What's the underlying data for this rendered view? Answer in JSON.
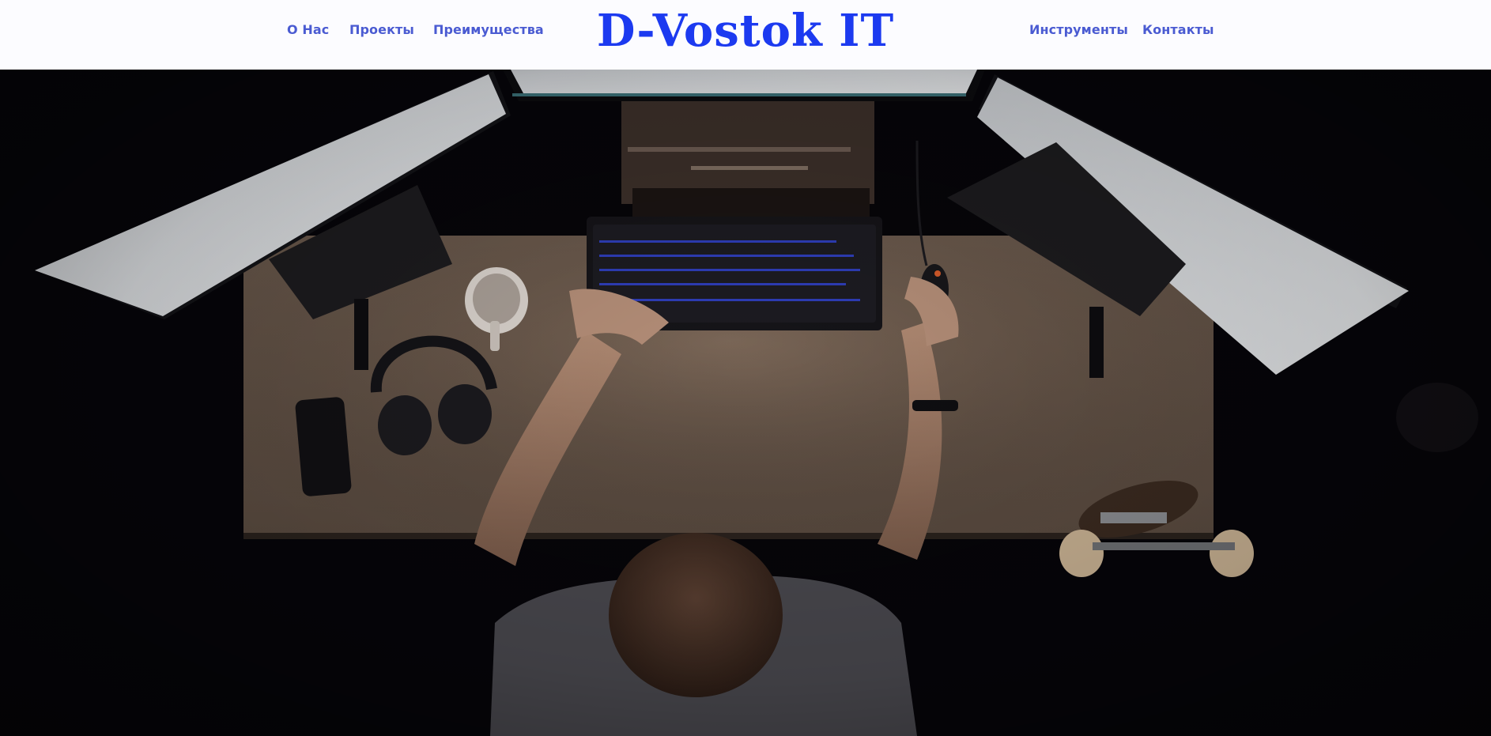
{
  "header": {
    "logo": "D-Vostok IT",
    "nav_left": [
      "О Нас",
      "Проекты",
      "Преимущества"
    ],
    "nav_right": [
      "Инструменты",
      "Контакты"
    ]
  },
  "colors": {
    "header_bg": "#fcfcff",
    "logo": "#1c3af0",
    "nav_link": "#4a5bd2"
  },
  "hero": {
    "image": "workspace-photo",
    "icons": [
      "monitor-icon",
      "keyboard-icon",
      "mouse-icon",
      "headphones-icon",
      "phone-icon",
      "mug-icon",
      "skateboard-icon"
    ]
  }
}
